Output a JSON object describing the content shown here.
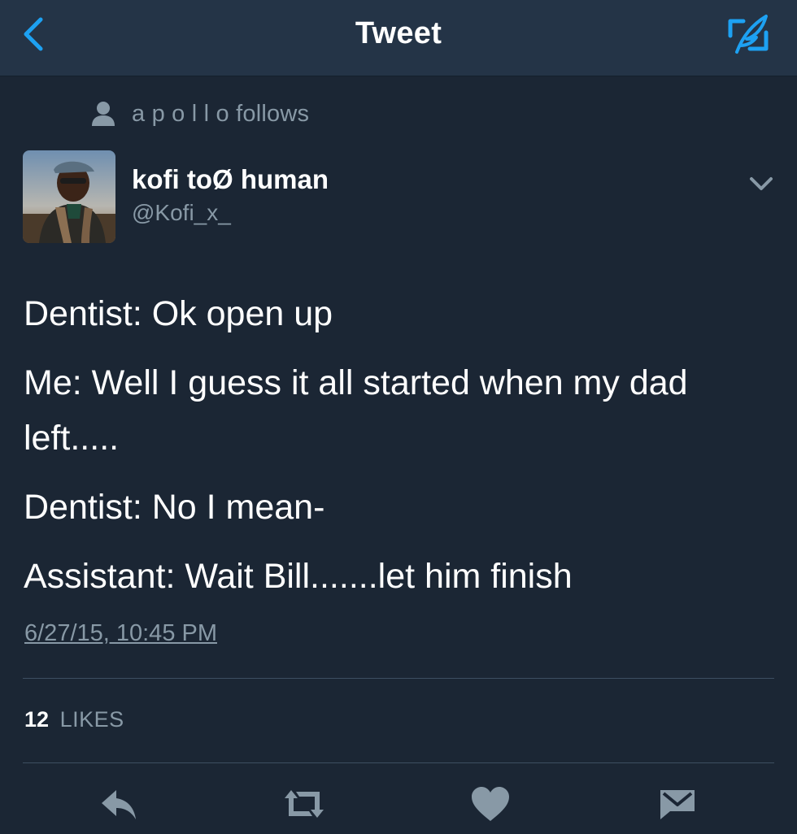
{
  "nav": {
    "back_icon": "chevron-left-icon",
    "title": "Tweet",
    "compose_icon": "compose-tweet-icon",
    "accent_color": "#1da1f2"
  },
  "social_context": {
    "icon": "person-icon",
    "text": "a p o l l o follows"
  },
  "author": {
    "name": "kofi toØ human",
    "handle": "@Kofi_x_",
    "avatar": "avatar-photo",
    "menu_icon": "chevron-down-icon"
  },
  "tweet": {
    "lines": [
      "Dentist: Ok open up",
      "Me: Well I guess it all started when my dad left.....",
      "Dentist: No I mean-",
      "Assistant: Wait Bill.......let him finish"
    ],
    "timestamp": "6/27/15, 10:45 PM"
  },
  "stats": {
    "likes_count": "12",
    "likes_label": "LIKES"
  },
  "actions": [
    {
      "name": "reply",
      "icon": "reply-icon"
    },
    {
      "name": "retweet",
      "icon": "retweet-icon"
    },
    {
      "name": "like",
      "icon": "heart-icon"
    },
    {
      "name": "direct-message",
      "icon": "envelope-icon"
    }
  ],
  "colors": {
    "background": "#1b2634",
    "nav_background": "#243447",
    "secondary_text": "#8899a6",
    "icon_gray": "#8899a6"
  }
}
